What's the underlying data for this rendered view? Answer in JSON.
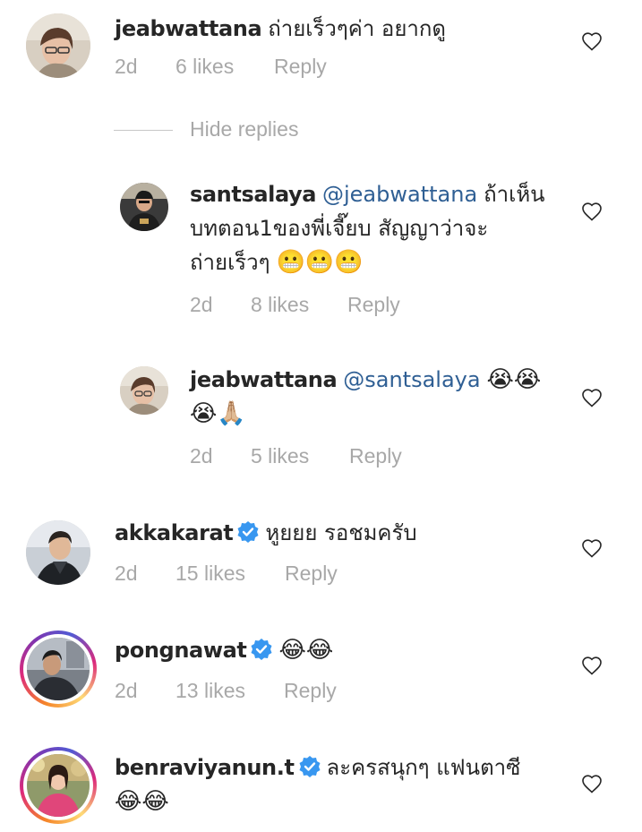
{
  "comments": [
    {
      "username": "jeabwattana",
      "text": "ถ่ายเร็วๆค่า อยากดู",
      "time": "2d",
      "likes": "6 likes",
      "reply": "Reply",
      "avatar_icon": "profile-photo"
    },
    {
      "username": "santsalaya",
      "mention": "@jeabwattana",
      "text_line1": "ถ้าเห็น",
      "text_line2": "บทตอน1ของพี่เจี๊ยบ สัญญาว่าจะ",
      "text_line3": "ถ่ายเร็วๆ",
      "emoji": "😬😬😬",
      "time": "2d",
      "likes": "8 likes",
      "reply": "Reply"
    },
    {
      "username": "jeabwattana",
      "mention": "@santsalaya",
      "emoji_line1": "😭😭",
      "emoji_line2": "😭🙏🏼",
      "time": "2d",
      "likes": "5 likes",
      "reply": "Reply"
    },
    {
      "username": "akkakarat",
      "verified": true,
      "text": "หูยยย รอชมครับ",
      "time": "2d",
      "likes": "15 likes",
      "reply": "Reply"
    },
    {
      "username": "pongnawat",
      "verified": true,
      "emoji": "😂😂",
      "time": "2d",
      "likes": "13 likes",
      "reply": "Reply"
    },
    {
      "username": "benraviyanun.t",
      "verified": true,
      "text": "ละครสนุกๆ แฟนตาซี",
      "emoji": "😂😂"
    }
  ],
  "hide_replies": "Hide replies",
  "colors": {
    "username": "#262626",
    "meta": "#a8a8a8",
    "mention": "#2f5f94",
    "verified": "#3897f0"
  }
}
